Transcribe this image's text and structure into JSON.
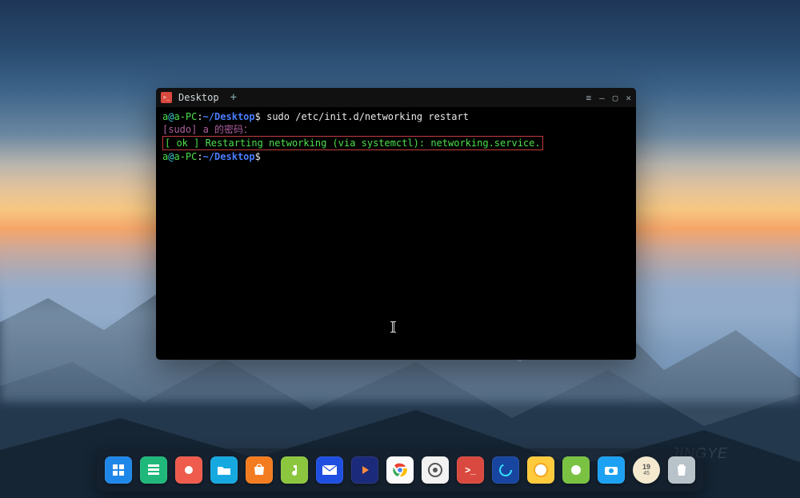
{
  "terminal": {
    "tab_title": "Desktop",
    "line1": {
      "user": "a",
      "at": "@",
      "host": "a-PC",
      "colon": ":",
      "path": "~/Desktop",
      "dollar": "$ ",
      "command": "sudo /etc/init.d/networking restart"
    },
    "line2": "[sudo] a 的密码：",
    "line3": "[ ok ] Restarting networking (via systemctl): networking.service.",
    "line4": {
      "user": "a",
      "at": "@",
      "host": "a-PC",
      "colon": ":",
      "path": "~/Desktop",
      "dollar": "$"
    }
  },
  "dock": {
    "clock_hour": "19",
    "clock_min": "45"
  },
  "watermark": "JINGYE"
}
